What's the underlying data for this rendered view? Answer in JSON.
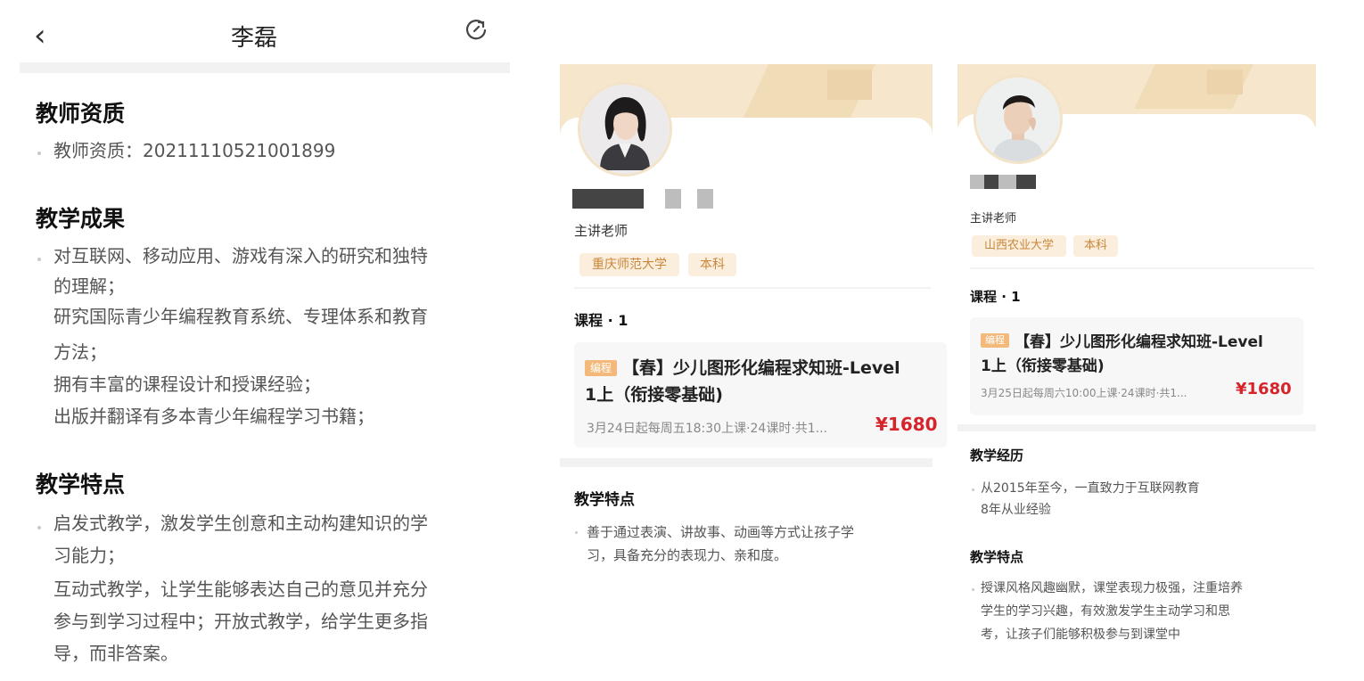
{
  "panel1": {
    "nav": {
      "back_icon": "‹",
      "title": "李磊",
      "refresh_icon": "refresh-icon"
    },
    "qualification": {
      "heading": "教师资质",
      "text": "教师资质：20211110521001899"
    },
    "achievements": {
      "heading": "教学成果",
      "lines": [
        "对互联网、移动应用、游戏有深入的研究和独特",
        "的理解；",
        "研究国际青少年编程教育系统、专理体系和教育",
        "方法；",
        "拥有丰富的课程设计和授课经验；",
        "出版并翻译有多本青少年编程学习书籍；"
      ]
    },
    "features": {
      "heading": "教学特点",
      "lines": [
        "启发式教学，激发学生创意和主动构建知识的学",
        "习能力；",
        "互动式教学，让学生能够表达自己的意见并充分",
        "参与到学习过程中；开放式教学，给学生更多指",
        "导，而非答案。"
      ]
    }
  },
  "panel2": {
    "role": "主讲老师",
    "tags": [
      "重庆师范大学",
      "本科"
    ],
    "courses_heading": "课程 · 1",
    "course": {
      "tag": "编程",
      "title_line1": "【春】少儿图形化编程求知班-Level",
      "title_line2": "1上（衔接零基础)",
      "meta": "3月24日起每周五18:30上课·24课时·共1...",
      "price": "¥1680"
    },
    "features": {
      "heading": "教学特点",
      "lines": [
        "善于通过表演、讲故事、动画等方式让孩子学",
        "习，具备充分的表现力、亲和度。"
      ]
    }
  },
  "panel3": {
    "role": "主讲老师",
    "tags": [
      "山西农业大学",
      "本科"
    ],
    "courses_heading": "课程 · 1",
    "course": {
      "tag": "编程",
      "title_line1": "【春】少儿图形化编程求知班-Level",
      "title_line2": "1上（衔接零基础)",
      "meta": "3月25日起每周六10:00上课·24课时·共1...",
      "price": "¥1680"
    },
    "experience": {
      "heading": "教学经历",
      "lines": [
        "从2015年至今，一直致力于互联网教育",
        "8年从业经验"
      ]
    },
    "features": {
      "heading": "教学特点",
      "lines": [
        "授课风格风趣幽默，课堂表现力极强，注重培养",
        "学生的学习兴趣，有效激发学生主动学习和思",
        "考，让孩子们能够积极参与到课堂中"
      ]
    }
  }
}
